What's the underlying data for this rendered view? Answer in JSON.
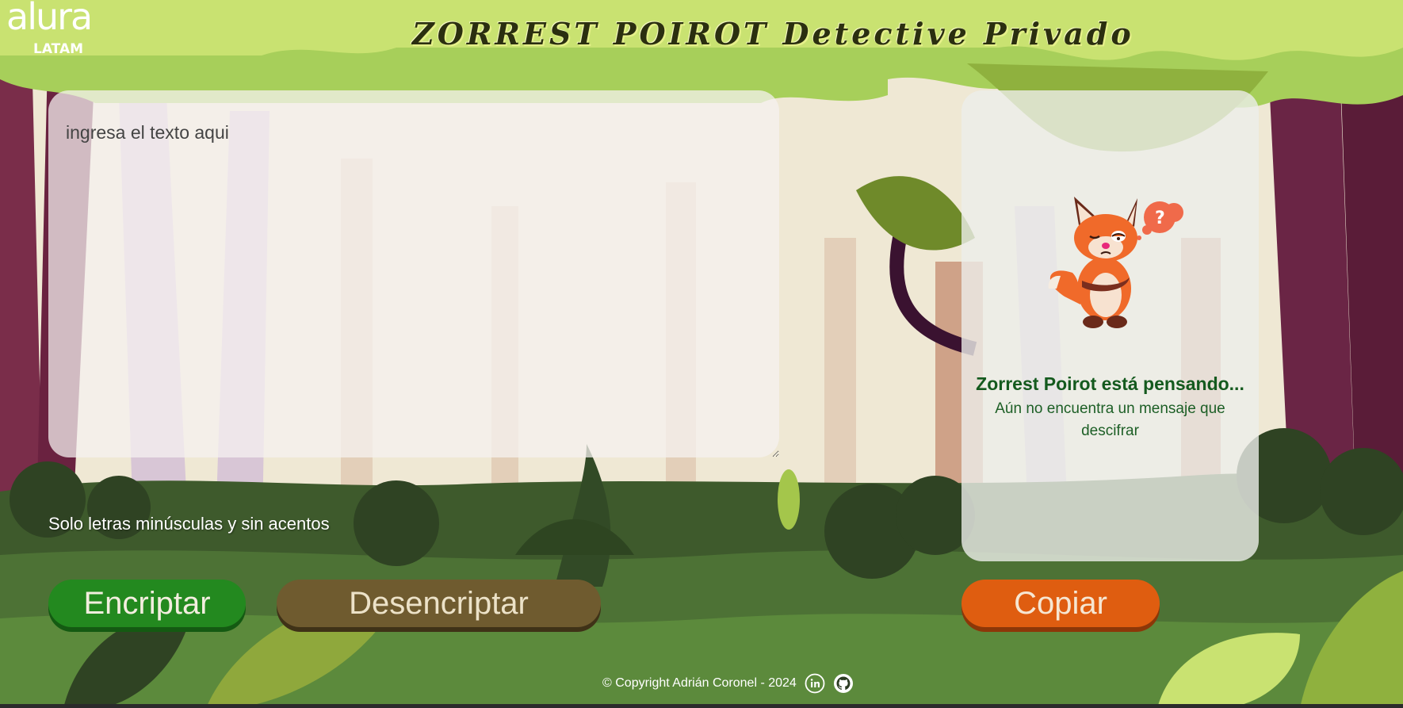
{
  "header": {
    "logo_word": "alura",
    "logo_sub": "LATAM",
    "title": "ZORREST POIROT Detective Privado"
  },
  "editor": {
    "placeholder": "ingresa el texto aqui"
  },
  "hint": {
    "text": "Solo letras minúsculas y sin acentos"
  },
  "buttons": {
    "encrypt": "Encriptar",
    "decrypt": "Desencriptar",
    "copy": "Copiar"
  },
  "result": {
    "title": "Zorrest Poirot está pensando...",
    "message": "Aún no encuentra un mensaje que descifrar"
  },
  "footer": {
    "copyright": "© Copyright Adrián Coronel - 2024",
    "icons": [
      "linkedin-icon",
      "github-icon"
    ]
  },
  "colors": {
    "encrypt_button": "#23891f",
    "decrypt_button": "#6f5b2f",
    "copy_button": "#df5d10",
    "result_title": "#145a1e"
  }
}
